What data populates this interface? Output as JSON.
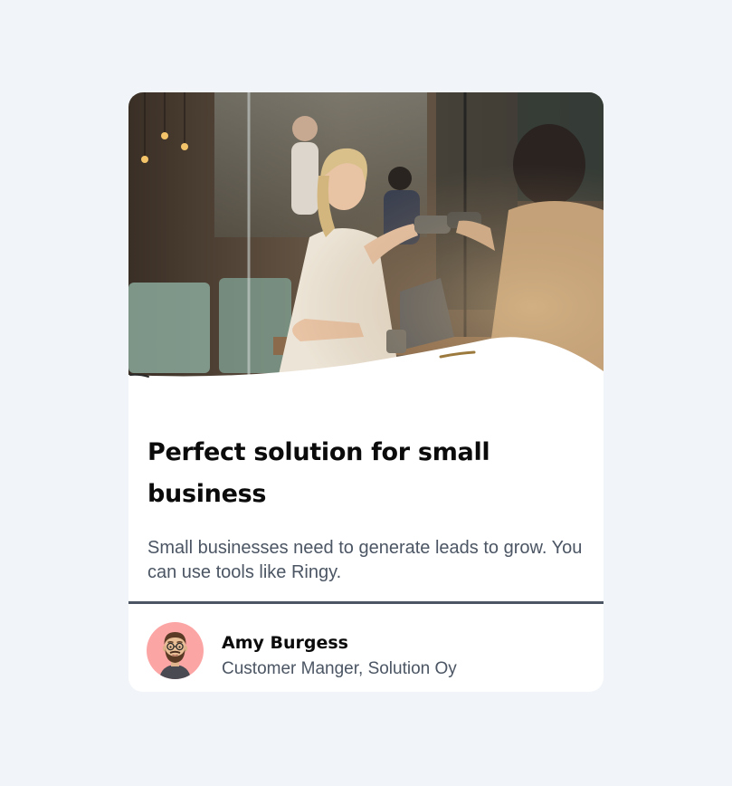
{
  "card": {
    "title": "Perfect solution for small business",
    "description": "Small businesses need to generate leads to grow. You can use tools like Ringy.",
    "author": {
      "name": "Amy Burgess",
      "role": "Customer Manger, Solution Oy",
      "avatar_icon": "bearded-man-avatar-icon"
    },
    "hero_image": "cafe-coffee-handoff-photo"
  },
  "colors": {
    "page_background": "#f1f5f9",
    "card_background": "#ffffff",
    "title": "#0b0b0b",
    "body_text": "#4b5563",
    "divider": "#4b5563",
    "avatar_background": "#fca5a5"
  }
}
